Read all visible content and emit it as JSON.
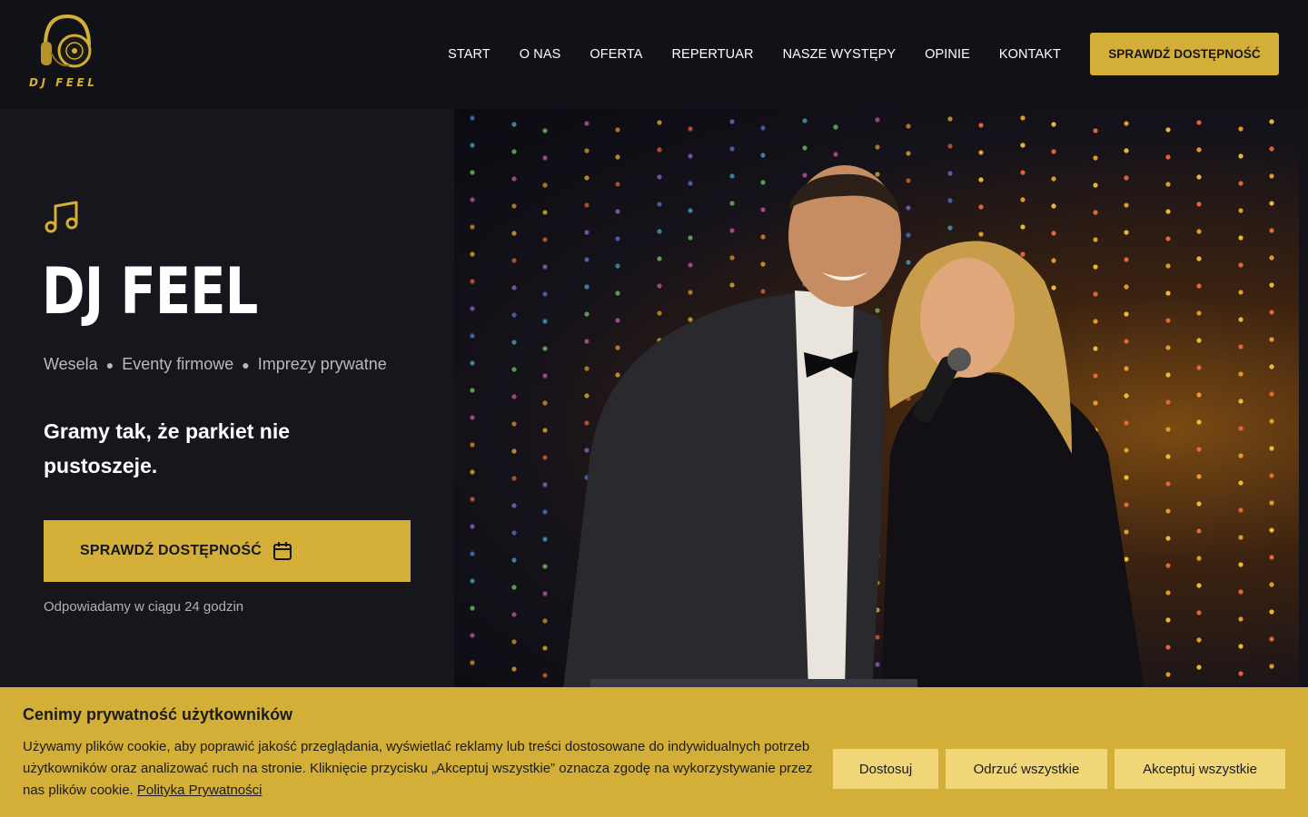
{
  "brand": {
    "name": "DJ FEEL",
    "logo_text": "DJ FEEL",
    "accent_color": "#d4af37",
    "bg_color": "#17161c"
  },
  "nav": {
    "items": [
      "START",
      "O NAS",
      "OFERTA",
      "REPERTUAR",
      "NASZE WYSTĘPY",
      "OPINIE",
      "KONTAKT"
    ],
    "cta": "SPRAWDŹ DOSTĘPNOŚĆ"
  },
  "hero": {
    "icon": "music-note-icon",
    "title": "DJ FEEL",
    "tags": [
      "Wesela",
      "Eventy firmowe",
      "Imprezy prywatne"
    ],
    "tagline": "Gramy tak, że parkiet nie pustoszeje.",
    "cta": "SPRAWDŹ DOSTĘPNOŚĆ",
    "cta_icon": "calendar-icon",
    "response_note": "Odpowiadamy w ciągu 24 godzin"
  },
  "cookie": {
    "title": "Cenimy prywatność użytkowników",
    "text": "Używamy plików cookie, aby poprawić jakość przeglądania, wyświetlać reklamy lub treści dostosowane do indywidualnych potrzeb użytkowników oraz analizować ruch na stronie. Kliknięcie przycisku „Akceptuj wszystkie” oznacza zgodę na wykorzystywanie przez nas plików cookie.",
    "policy_link": "Polityka Prywatności",
    "buttons": {
      "customize": "Dostosuj",
      "reject": "Odrzuć wszystkie",
      "accept": "Akceptuj wszystkie"
    }
  }
}
